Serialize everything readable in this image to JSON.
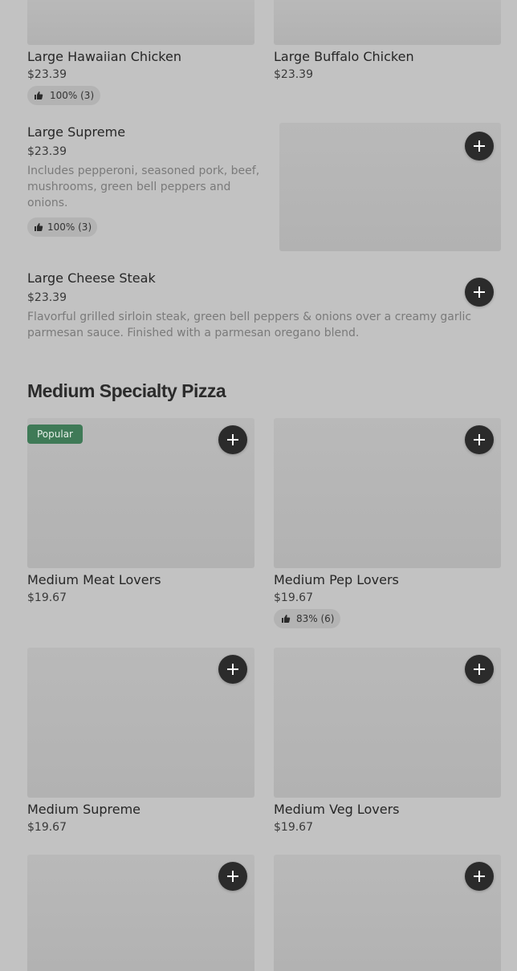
{
  "top_items": [
    {
      "name": "Large Hawaiian Chicken",
      "price": "$23.39",
      "rating": "100% (3)"
    },
    {
      "name": "Large Buffalo Chicken",
      "price": "$23.39"
    }
  ],
  "featured_items": [
    {
      "name": "Large Supreme",
      "price": "$23.39",
      "description": "Includes pepperoni, seasoned pork, beef, mushrooms, green bell peppers and onions.",
      "rating": "100% (3)"
    },
    {
      "name": "Large Cheese Steak",
      "price": "$23.39",
      "description": "Flavorful grilled sirloin steak, green bell peppers & onions over a creamy garlic parmesan sauce. Finished with a parmesan oregano blend."
    }
  ],
  "section": {
    "title": "Medium Specialty Pizza",
    "items": [
      {
        "name": "Medium Meat Lovers",
        "price": "$19.67",
        "badge": "Popular"
      },
      {
        "name": "Medium Pep Lovers",
        "price": "$19.67",
        "rating": "83% (6)"
      },
      {
        "name": "Medium Supreme",
        "price": "$19.67"
      },
      {
        "name": "Medium Veg Lovers",
        "price": "$19.67"
      }
    ]
  },
  "icons": {
    "add": "plus-icon",
    "rating": "thumbs-up-icon"
  },
  "colors": {
    "background": "#c2c2c2",
    "add_button": "#2b2b2b",
    "popular_badge": "#3f7a57"
  }
}
